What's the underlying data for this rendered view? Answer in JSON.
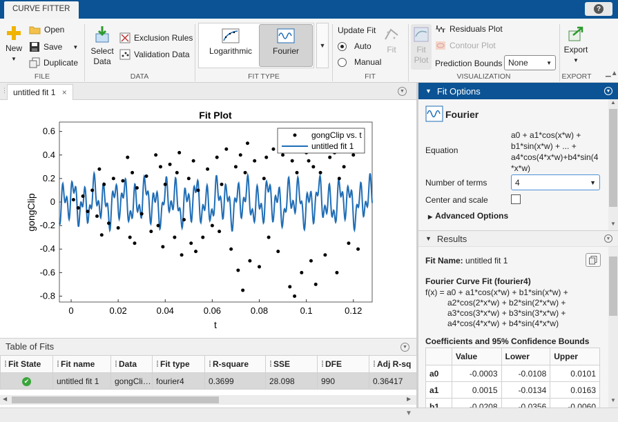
{
  "app_tab": "CURVE FITTER",
  "toolstrip": {
    "file": {
      "new": "New",
      "open": "Open",
      "save": "Save",
      "duplicate": "Duplicate",
      "label": "FILE"
    },
    "data": {
      "select": "Select Data",
      "exclusion": "Exclusion Rules",
      "validation": "Validation Data",
      "label": "DATA"
    },
    "fit_type": {
      "log": "Logarithmic",
      "fourier": "Fourier",
      "label": "FIT TYPE"
    },
    "fit": {
      "update": "Update Fit",
      "auto": "Auto",
      "manual": "Manual",
      "fit": "Fit",
      "label": "FIT"
    },
    "visualization": {
      "fit_plot": "Fit Plot",
      "residuals": "Residuals Plot",
      "contour": "Contour Plot",
      "pred_bounds": "Prediction Bounds",
      "pred_value": "None",
      "label": "VISUALIZATION"
    },
    "export": {
      "export": "Export",
      "label": "EXPORT"
    }
  },
  "doc_tab": "untitled fit 1",
  "chart_data": {
    "type": "scatter",
    "title": "Fit Plot",
    "xlabel": "t",
    "ylabel": "gongClip",
    "xlim": [
      -0.005,
      0.128
    ],
    "ylim": [
      -0.85,
      0.68
    ],
    "xticks": [
      "0",
      "0.02",
      "0.04",
      "0.06",
      "0.08",
      "0.1",
      "0.12"
    ],
    "xtick_values": [
      0,
      0.02,
      0.04,
      0.06,
      0.08,
      0.1,
      0.12
    ],
    "yticks": [
      "0.6",
      "0.4",
      "0.2",
      "0",
      "-0.2",
      "-0.4",
      "-0.6",
      "-0.8"
    ],
    "ytick_values": [
      0.6,
      0.4,
      0.2,
      0,
      -0.2,
      -0.4,
      -0.6,
      -0.8
    ],
    "legend_position": "top-right",
    "series": [
      {
        "name": "gongClip vs. t",
        "kind": "points",
        "color": "#000000",
        "x": [
          0.001,
          0.003,
          0.005,
          0.007,
          0.009,
          0.011,
          0.012,
          0.013,
          0.014,
          0.016,
          0.018,
          0.02,
          0.022,
          0.024,
          0.025,
          0.026,
          0.027,
          0.028,
          0.03,
          0.032,
          0.034,
          0.036,
          0.037,
          0.038,
          0.039,
          0.04,
          0.042,
          0.044,
          0.045,
          0.046,
          0.047,
          0.048,
          0.05,
          0.051,
          0.052,
          0.053,
          0.054,
          0.056,
          0.058,
          0.06,
          0.062,
          0.063,
          0.064,
          0.066,
          0.068,
          0.07,
          0.071,
          0.072,
          0.073,
          0.074,
          0.075,
          0.076,
          0.078,
          0.08,
          0.082,
          0.083,
          0.084,
          0.086,
          0.088,
          0.09,
          0.092,
          0.093,
          0.094,
          0.095,
          0.096,
          0.098,
          0.1,
          0.101,
          0.102,
          0.103,
          0.104,
          0.106,
          0.108,
          0.11,
          0.112,
          0.113,
          0.114,
          0.116,
          0.118,
          0.12,
          0.122
        ],
        "y": [
          0.02,
          -0.05,
          0.05,
          -0.08,
          0.1,
          -0.12,
          0.28,
          -0.28,
          0.15,
          -0.18,
          0.2,
          -0.22,
          0.18,
          0.38,
          -0.3,
          0.25,
          -0.35,
          0.12,
          -0.1,
          0.22,
          -0.25,
          0.4,
          -0.2,
          0.3,
          -0.38,
          0.15,
          0.32,
          -0.3,
          0.25,
          0.42,
          -0.45,
          -0.15,
          0.2,
          -0.35,
          0.35,
          -0.42,
          0.1,
          -0.3,
          0.28,
          -0.2,
          0.38,
          -0.25,
          0.15,
          0.45,
          -0.4,
          0.3,
          -0.58,
          0.4,
          -0.75,
          0.25,
          0.5,
          -0.5,
          0.35,
          -0.55,
          0.2,
          0.38,
          -0.3,
          0.45,
          -0.42,
          0.4,
          0.55,
          -0.72,
          0.35,
          -0.8,
          0.25,
          -0.6,
          0.42,
          0.35,
          -0.5,
          0.3,
          -0.7,
          0.25,
          -0.45,
          0.38,
          0.42,
          -0.6,
          0.2,
          0.3,
          -0.35,
          0.4,
          -0.4
        ]
      },
      {
        "name": "untitled fit 1",
        "kind": "line",
        "color": "#1f6db5"
      }
    ]
  },
  "table_of_fits": {
    "title": "Table of Fits",
    "columns": [
      "Fit State",
      "Fit name",
      "Data",
      "Fit type",
      "R-square",
      "SSE",
      "DFE",
      "Adj R-sq"
    ],
    "rows": [
      [
        "✔",
        "untitled fit 1",
        "gongCli…",
        "fourier4",
        "0.3699",
        "28.098",
        "990",
        "0.36417"
      ]
    ]
  },
  "fit_options": {
    "title": "Fit Options",
    "name": "Fourier",
    "equation_label": "Equation",
    "equation_lines": [
      "a0 + a1*cos(x*w) +",
      "b1*sin(x*w) + ... +",
      "a4*cos(4*x*w)+b4*sin(4",
      "*x*w)"
    ],
    "terms_label": "Number of terms",
    "terms_value": "4",
    "center_label": "Center and scale",
    "advanced": "Advanced Options"
  },
  "results": {
    "title": "Results",
    "fit_name_label": "Fit Name:",
    "fit_name": "untitled fit 1",
    "heading": "Fourier Curve Fit (fourier4)",
    "formula_lines": [
      "f(x) = a0 + a1*cos(x*w) + b1*sin(x*w) +",
      "a2*cos(2*x*w) + b2*sin(2*x*w) +",
      "a3*cos(3*x*w) + b3*sin(3*x*w) +",
      "a4*cos(4*x*w) + b4*sin(4*x*w)"
    ],
    "coef_heading": "Coefficients and 95% Confidence Bounds",
    "coef_columns": [
      "",
      "Value",
      "Lower",
      "Upper"
    ],
    "coef_rows": [
      [
        "a0",
        "-0.0003",
        "-0.0108",
        "0.0101"
      ],
      [
        "a1",
        "0.0015",
        "-0.0134",
        "0.0163"
      ],
      [
        "b1",
        "-0.0208",
        "-0.0356",
        "-0.0060"
      ]
    ]
  },
  "colors": {
    "accent": "#0b5394",
    "fit_line": "#1f6db5",
    "status_ok": "#3aa53a"
  }
}
